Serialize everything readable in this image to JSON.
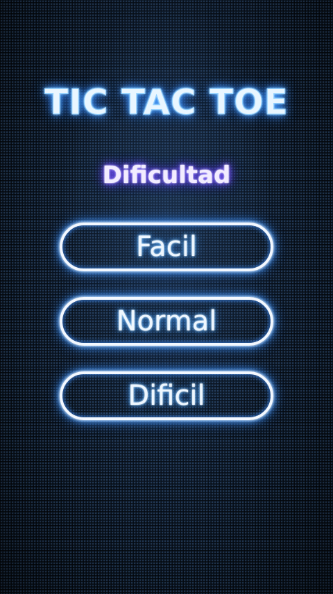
{
  "title": "TIC TAC TOE",
  "subtitle": "Dificultad",
  "buttons": {
    "easy": "Facil",
    "normal": "Normal",
    "hard": "Dificil"
  },
  "colors": {
    "background": "#0f1d2e",
    "title_glow": "#3a8fff",
    "subtitle_glow": "#6a4cff",
    "button_border": "#f3f8ff"
  }
}
